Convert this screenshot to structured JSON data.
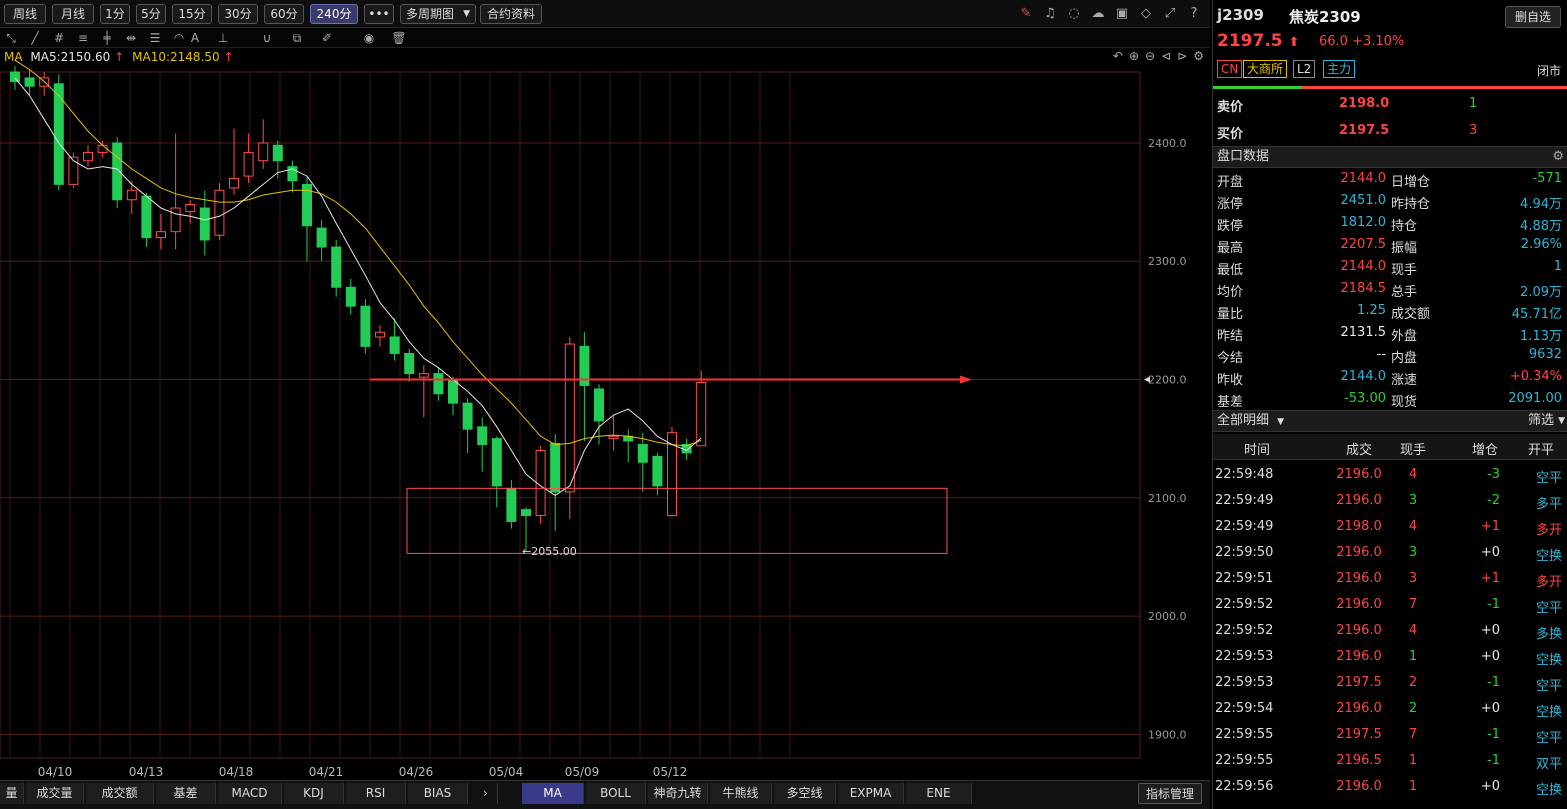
{
  "periods": [
    "周线",
    "月线",
    "1分",
    "5分",
    "15分",
    "30分",
    "60分",
    "240分"
  ],
  "active_period": "240分",
  "more_label": "•••",
  "multi_period": "多周期图",
  "contract_info": "合约资料",
  "toolbar_icons": [
    "magnet-icon",
    "copy-icon",
    "pen-icon",
    "ray-icon",
    "cross-line-icon",
    "width-line-icon",
    "text-icon",
    "eye-icon",
    "trash-icon"
  ],
  "ma_legend": {
    "label": "MA",
    "ma5": "MA5:2150.60",
    "ma10": "MA10:2148.50",
    "ma5_color": "#e6e6e6",
    "ma10_color": "#e6c200"
  },
  "chart_data": {
    "type": "candlestick",
    "y_ticks": [
      "2400.0",
      "2300.0",
      "2200.0",
      "2100.0",
      "2000.0",
      "1900.0"
    ],
    "y_values": [
      2400,
      2300,
      2200,
      2100,
      2000,
      1900
    ],
    "ylim": [
      1880,
      2460
    ],
    "x_dates": [
      "04/10",
      "04/13",
      "04/18",
      "04/21",
      "04/26",
      "05/04",
      "05/09",
      "05/12"
    ],
    "min_label": "←2055.00",
    "min_value": 2055,
    "candles": [
      {
        "o": 2460,
        "c": 2452,
        "h": 2465,
        "l": 2445
      },
      {
        "o": 2455,
        "c": 2448,
        "h": 2462,
        "l": 2440
      },
      {
        "o": 2448,
        "c": 2455,
        "h": 2460,
        "l": 2440
      },
      {
        "o": 2450,
        "c": 2365,
        "h": 2458,
        "l": 2360
      },
      {
        "o": 2365,
        "c": 2388,
        "h": 2392,
        "l": 2362
      },
      {
        "o": 2385,
        "c": 2392,
        "h": 2398,
        "l": 2380
      },
      {
        "o": 2392,
        "c": 2398,
        "h": 2402,
        "l": 2388
      },
      {
        "o": 2400,
        "c": 2352,
        "h": 2405,
        "l": 2345
      },
      {
        "o": 2352,
        "c": 2360,
        "h": 2368,
        "l": 2340
      },
      {
        "o": 2355,
        "c": 2320,
        "h": 2358,
        "l": 2312
      },
      {
        "o": 2320,
        "c": 2325,
        "h": 2340,
        "l": 2310
      },
      {
        "o": 2325,
        "c": 2345,
        "h": 2408,
        "l": 2310
      },
      {
        "o": 2342,
        "c": 2348,
        "h": 2352,
        "l": 2332
      },
      {
        "o": 2345,
        "c": 2318,
        "h": 2360,
        "l": 2305
      },
      {
        "o": 2322,
        "c": 2360,
        "h": 2366,
        "l": 2318
      },
      {
        "o": 2362,
        "c": 2370,
        "h": 2412,
        "l": 2356
      },
      {
        "o": 2372,
        "c": 2392,
        "h": 2408,
        "l": 2366
      },
      {
        "o": 2385,
        "c": 2400,
        "h": 2420,
        "l": 2378
      },
      {
        "o": 2398,
        "c": 2385,
        "h": 2402,
        "l": 2370
      },
      {
        "o": 2380,
        "c": 2368,
        "h": 2385,
        "l": 2358
      },
      {
        "o": 2365,
        "c": 2330,
        "h": 2372,
        "l": 2300
      },
      {
        "o": 2328,
        "c": 2312,
        "h": 2335,
        "l": 2300
      },
      {
        "o": 2312,
        "c": 2278,
        "h": 2318,
        "l": 2270
      },
      {
        "o": 2278,
        "c": 2262,
        "h": 2285,
        "l": 2255
      },
      {
        "o": 2262,
        "c": 2228,
        "h": 2268,
        "l": 2222
      },
      {
        "o": 2236,
        "c": 2240,
        "h": 2246,
        "l": 2228
      },
      {
        "o": 2236,
        "c": 2222,
        "h": 2252,
        "l": 2216
      },
      {
        "o": 2222,
        "c": 2205,
        "h": 2226,
        "l": 2198
      },
      {
        "o": 2202,
        "c": 2205,
        "h": 2212,
        "l": 2168
      },
      {
        "o": 2205,
        "c": 2188,
        "h": 2210,
        "l": 2182
      },
      {
        "o": 2200,
        "c": 2180,
        "h": 2202,
        "l": 2170
      },
      {
        "o": 2180,
        "c": 2158,
        "h": 2184,
        "l": 2138
      },
      {
        "o": 2160,
        "c": 2145,
        "h": 2168,
        "l": 2122
      },
      {
        "o": 2150,
        "c": 2110,
        "h": 2152,
        "l": 2092
      },
      {
        "o": 2108,
        "c": 2080,
        "h": 2115,
        "l": 2074
      },
      {
        "o": 2090,
        "c": 2085,
        "h": 2092,
        "l": 2055
      },
      {
        "o": 2085,
        "c": 2140,
        "h": 2144,
        "l": 2078
      },
      {
        "o": 2146,
        "c": 2105,
        "h": 2154,
        "l": 2072
      },
      {
        "o": 2105,
        "c": 2230,
        "h": 2236,
        "l": 2082
      },
      {
        "o": 2228,
        "c": 2195,
        "h": 2240,
        "l": 2148
      },
      {
        "o": 2192,
        "c": 2165,
        "h": 2196,
        "l": 2145
      },
      {
        "o": 2150,
        "c": 2152,
        "h": 2170,
        "l": 2140
      },
      {
        "o": 2152,
        "c": 2148,
        "h": 2158,
        "l": 2130
      },
      {
        "o": 2145,
        "c": 2130,
        "h": 2155,
        "l": 2105
      },
      {
        "o": 2135,
        "c": 2110,
        "h": 2138,
        "l": 2102
      },
      {
        "o": 2085,
        "c": 2155,
        "h": 2160,
        "l": 2084
      },
      {
        "o": 2145,
        "c": 2138,
        "h": 2150,
        "l": 2132
      },
      {
        "o": 2144,
        "c": 2197.5,
        "h": 2207.5,
        "l": 2144
      }
    ],
    "ma5": [
      2455,
      2440,
      2420,
      2400,
      2385,
      2378,
      2380,
      2378,
      2365,
      2355,
      2345,
      2340,
      2338,
      2335,
      2338,
      2345,
      2355,
      2365,
      2375,
      2378,
      2372,
      2355,
      2332,
      2310,
      2288,
      2265,
      2250,
      2232,
      2218,
      2210,
      2200,
      2190,
      2178,
      2160,
      2140,
      2120,
      2110,
      2102,
      2110,
      2140,
      2160,
      2170,
      2175,
      2165,
      2152,
      2145,
      2140,
      2150.6
    ],
    "ma10": [
      2470,
      2462,
      2452,
      2440,
      2425,
      2410,
      2398,
      2388,
      2378,
      2370,
      2362,
      2357,
      2354,
      2352,
      2350,
      2350,
      2352,
      2356,
      2358,
      2360,
      2360,
      2357,
      2350,
      2340,
      2328,
      2312,
      2296,
      2280,
      2262,
      2248,
      2232,
      2218,
      2204,
      2192,
      2180,
      2166,
      2152,
      2145,
      2146,
      2150,
      2152,
      2153,
      2152,
      2150,
      2147,
      2145,
      2144,
      2148.5
    ]
  },
  "indicator_tabs": [
    "量",
    "成交量",
    "成交额",
    "基差",
    "MACD",
    "KDJ",
    "RSI",
    "BIAS",
    "MA",
    "BOLL",
    "神奇九转",
    "牛熊线",
    "多空线",
    "EXPMA",
    "ENE"
  ],
  "active_indicator": "MA",
  "indicator_manage": "指标管理",
  "quote": {
    "code": "j2309",
    "name": "焦炭2309",
    "remove_watch": "删自选",
    "price": "2197.5",
    "arrow": "⬆",
    "change": "66.0 +3.10%",
    "badges": [
      "CN",
      "大商所",
      "L2",
      "主力"
    ],
    "status": "闭市",
    "ask_label": "卖价",
    "ask_price": "2198.0",
    "ask_vol": "1",
    "bid_label": "买价",
    "bid_price": "2197.5",
    "bid_vol": "3"
  },
  "panel_title": "盘口数据",
  "stats": [
    {
      "l1": "开盘",
      "v1": "2144.0",
      "c1": "red",
      "l2": "日增仓",
      "v2": "-571",
      "c2": "green"
    },
    {
      "l1": "涨停",
      "v1": "2451.0",
      "c1": "cyan",
      "l2": "昨持仓",
      "v2": "4.94万",
      "c2": "cyan"
    },
    {
      "l1": "跌停",
      "v1": "1812.0",
      "c1": "cyan",
      "l2": "持仓",
      "v2": "4.88万",
      "c2": "cyan"
    },
    {
      "l1": "最高",
      "v1": "2207.5",
      "c1": "red",
      "l2": "振幅",
      "v2": "2.96%",
      "c2": "cyan"
    },
    {
      "l1": "最低",
      "v1": "2144.0",
      "c1": "red",
      "l2": "现手",
      "v2": "1",
      "c2": "cyan"
    },
    {
      "l1": "均价",
      "v1": "2184.5",
      "c1": "red",
      "l2": "总手",
      "v2": "2.09万",
      "c2": "cyan"
    },
    {
      "l1": "量比",
      "v1": "1.25",
      "c1": "cyan",
      "l2": "成交额",
      "v2": "45.71亿",
      "c2": "cyan"
    },
    {
      "l1": "昨结",
      "v1": "2131.5",
      "c1": "white",
      "l2": "外盘",
      "v2": "1.13万",
      "c2": "cyan"
    },
    {
      "l1": "今结",
      "v1": "--",
      "c1": "white",
      "l2": "内盘",
      "v2": "9632",
      "c2": "cyan"
    },
    {
      "l1": "昨收",
      "v1": "2144.0",
      "c1": "cyan",
      "l2": "涨速",
      "v2": "+0.34%",
      "c2": "red"
    },
    {
      "l1": "基差",
      "v1": "-53.00",
      "c1": "green",
      "l2": "现货",
      "v2": "2091.00",
      "c2": "cyan"
    }
  ],
  "detail_title": "全部明细",
  "filter_label": "筛选",
  "trade_headers": [
    "时间",
    "成交",
    "现手",
    "增仓",
    "开平"
  ],
  "trades": [
    {
      "time": "22:59:48",
      "price": "2196.0",
      "vol": "4",
      "vc": "red",
      "chg": "-3",
      "cc": "green",
      "type": "空平",
      "tc": "cyan"
    },
    {
      "time": "22:59:49",
      "price": "2196.0",
      "vol": "3",
      "vc": "green",
      "chg": "-2",
      "cc": "green",
      "type": "多平",
      "tc": "cyan"
    },
    {
      "time": "22:59:49",
      "price": "2198.0",
      "vol": "4",
      "vc": "red",
      "chg": "+1",
      "cc": "red",
      "type": "多开",
      "tc": "red"
    },
    {
      "time": "22:59:50",
      "price": "2196.0",
      "vol": "3",
      "vc": "green",
      "chg": "+0",
      "cc": "white",
      "type": "空换",
      "tc": "cyan"
    },
    {
      "time": "22:59:51",
      "price": "2196.0",
      "vol": "3",
      "vc": "red",
      "chg": "+1",
      "cc": "red",
      "type": "多开",
      "tc": "red"
    },
    {
      "time": "22:59:52",
      "price": "2196.0",
      "vol": "7",
      "vc": "red",
      "chg": "-1",
      "cc": "green",
      "type": "空平",
      "tc": "cyan"
    },
    {
      "time": "22:59:52",
      "price": "2196.0",
      "vol": "4",
      "vc": "red",
      "chg": "+0",
      "cc": "white",
      "type": "多换",
      "tc": "cyan"
    },
    {
      "time": "22:59:53",
      "price": "2196.0",
      "vol": "1",
      "vc": "green",
      "chg": "+0",
      "cc": "white",
      "type": "空换",
      "tc": "cyan"
    },
    {
      "time": "22:59:53",
      "price": "2197.5",
      "vol": "2",
      "vc": "red",
      "chg": "-1",
      "cc": "green",
      "type": "空平",
      "tc": "cyan"
    },
    {
      "time": "22:59:54",
      "price": "2196.0",
      "vol": "2",
      "vc": "green",
      "chg": "+0",
      "cc": "white",
      "type": "空换",
      "tc": "cyan"
    },
    {
      "time": "22:59:55",
      "price": "2197.5",
      "vol": "7",
      "vc": "red",
      "chg": "-1",
      "cc": "green",
      "type": "空平",
      "tc": "cyan"
    },
    {
      "time": "22:59:55",
      "price": "2196.5",
      "vol": "1",
      "vc": "red",
      "chg": "-1",
      "cc": "green",
      "type": "双平",
      "tc": "cyan"
    },
    {
      "time": "22:59:56",
      "price": "2196.0",
      "vol": "1",
      "vc": "red",
      "chg": "+0",
      "cc": "white",
      "type": "空换",
      "tc": "cyan"
    }
  ]
}
